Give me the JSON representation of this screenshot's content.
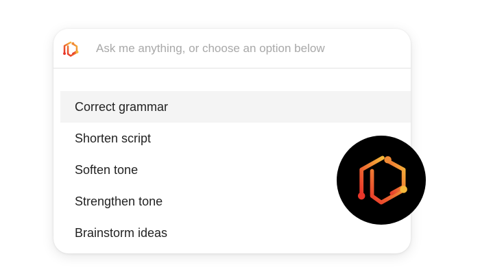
{
  "prompt": {
    "placeholder": "Ask me anything, or choose an option below",
    "value": "",
    "logo_icon": "ai-hexagon-logo-icon"
  },
  "options": [
    {
      "label": "Correct grammar",
      "highlighted": true
    },
    {
      "label": "Shorten script",
      "highlighted": false
    },
    {
      "label": "Soften tone",
      "highlighted": false
    },
    {
      "label": "Strengthen tone",
      "highlighted": false
    },
    {
      "label": "Brainstorm ideas",
      "highlighted": false
    }
  ],
  "badge": {
    "icon": "ai-hexagon-logo-icon",
    "background": "#000000"
  },
  "colors": {
    "gradient_start": "#e8362a",
    "gradient_end": "#f5b83a",
    "highlight_row": "#f4f4f4",
    "placeholder_text": "#a8a8a8",
    "option_text": "#222222"
  }
}
